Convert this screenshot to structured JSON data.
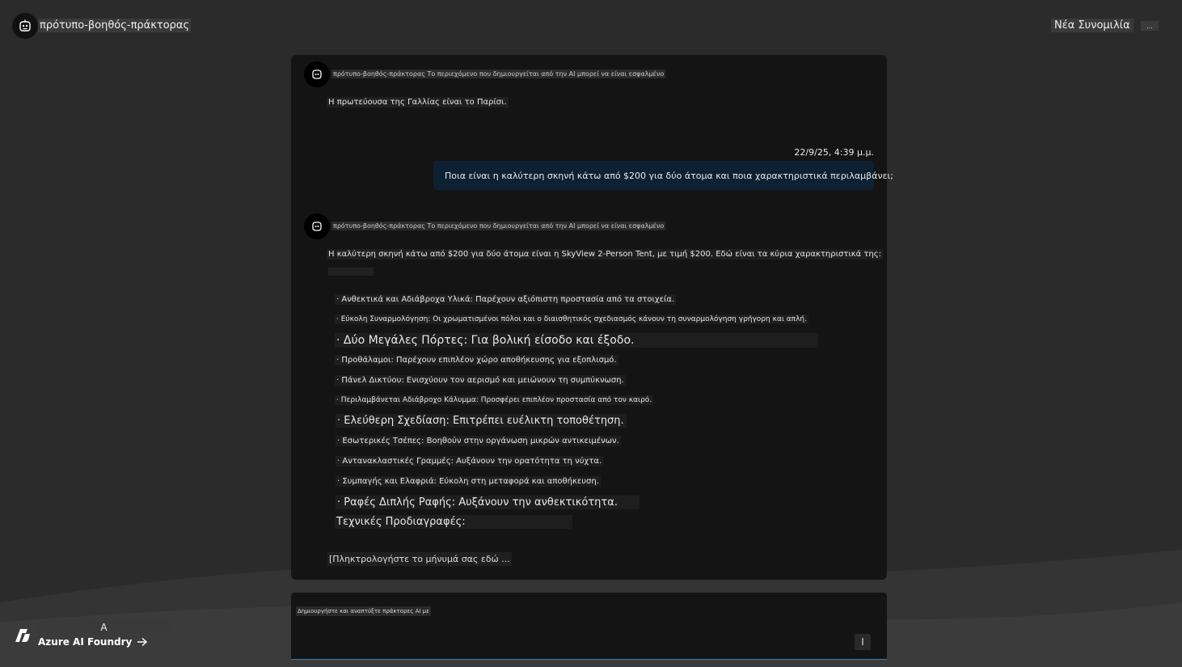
{
  "header": {
    "agent_name": "πρότυπο-βοηθός-πράκτορας",
    "new_chat_label": "Νέα Συνομιλία",
    "more_label": "..."
  },
  "chat": {
    "messages": [
      {
        "role": "assistant",
        "header": "πρότυπο-βοηθός-πράκτορας Το περιεχόμενο που δημιουργείται από την AI μπορεί να είναι εσφαλμένο",
        "text": "Η πρωτεύουσα της Γαλλίας είναι το Παρίσι."
      },
      {
        "role": "user",
        "timestamp": "22/9/25, 4:39 μ.μ.",
        "text": "Ποια είναι η καλύτερη σκηνή κάτω από $200 για δύο άτομα και ποια χαρακτηριστικά περιλαμβάνει;"
      },
      {
        "role": "assistant",
        "header": "πρότυπο-βοηθός-πράκτορας Το περιεχόμενο που δημιουργείται από την AI μπορεί να είναι εσφαλμένο",
        "intro": "Η καλύτερη σκηνή κάτω από $200 για δύο άτομα είναι η SkyView 2-Person Tent, με τιμή $200. Εδώ είναι τα κύρια χαρακτηριστικά της:",
        "bullets": [
          "· Ανθεκτικά και Αδιάβροχα Υλικά: Παρέχουν αξιόπιστη προστασία από τα στοιχεία.",
          "· Εύκολη Συναρμολόγηση: Οι χρωματισμένοι πόλοι και ο διαισθητικός σχεδιασμός κάνουν τη συναρμολόγηση γρήγορη και απλή.",
          "· Δύο Μεγάλες Πόρτες: Για βολική είσοδο και έξοδο.",
          "· Προθάλαμοι: Παρέχουν επιπλέον χώρο αποθήκευσης για εξοπλισμό.",
          "· Πάνελ Δικτύου: Ενισχύουν τον αερισμό και μειώνουν τη συμπύκνωση.",
          "· Περιλαμβάνεται Αδιάβροχο Κάλυμμα: Προσφέρει επιπλέον προστασία από τον καιρό.",
          "· Ελεύθερη Σχεδίαση: Επιτρέπει ευέλικτη τοποθέτηση.",
          "· Εσωτερικές Τσέπες: Βοηθούν στην οργάνωση μικρών αντικειμένων.",
          "· Αντανακλαστικές Γραμμές: Αυξάνουν την ορατότητα τη νύχτα.",
          "· Συμπαγής και Ελαφριά: Εύκολη στη μεταφορά και αποθήκευση.",
          "· Ραφές Διπλής Ραφής: Αυξάνουν την ανθεκτικότητα."
        ],
        "subheading": "Τεχνικές Προδιαγραφές:"
      }
    ],
    "input_placeholder": "[Πληκτρολογήστε το μήνυμά σας εδώ ..."
  },
  "composer": {
    "label": "Δημιουργήστε και αναπτύξτε πράκτορες AI με"
  },
  "footer": {
    "initial": "A",
    "brand": "Azure AI Foundry"
  },
  "colors": {
    "background": "#2b2b2b",
    "panel": "#141414",
    "user_bubble": "#0d2133",
    "accent_line": "#2a7fb8"
  }
}
